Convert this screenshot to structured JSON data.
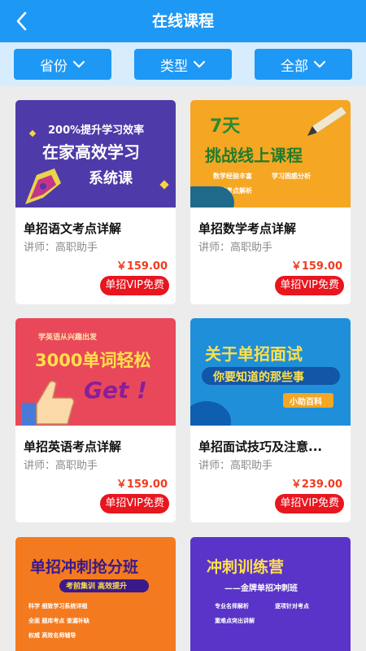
{
  "header": {
    "title": "在线课程"
  },
  "filters": [
    {
      "label": "省份"
    },
    {
      "label": "类型"
    },
    {
      "label": "全部"
    }
  ],
  "courses": [
    {
      "title": "单招语文考点详解",
      "teacher": "讲师：高职助手",
      "price": "￥159.00",
      "badge": "单招VIP免费",
      "thumb": {
        "line1": "200%提升学习效率",
        "line2": "在家高效学习",
        "line3": "系统课"
      }
    },
    {
      "title": "单招数学考点详解",
      "teacher": "讲师：高职助手",
      "price": "￥159.00",
      "badge": "单招VIP免费",
      "thumb": {
        "line1": "7天",
        "line2": "挑战线上课程",
        "bullet1": "数学经验丰富",
        "bullet2": "学习困惑分析",
        "bullet3": "课程考点解析"
      }
    },
    {
      "title": "单招英语考点详解",
      "teacher": "讲师：高职助手",
      "price": "￥159.00",
      "badge": "单招VIP免费",
      "thumb": {
        "line1": "学英语从兴趣出发",
        "line2": "3000单词轻松",
        "line3": "Get !"
      }
    },
    {
      "title": "单招面试技巧及注意...",
      "teacher": "讲师：高职助手",
      "price": "￥239.00",
      "badge": "单招VIP免费",
      "thumb": {
        "line1": "关于单招面试",
        "line2": "你要知道的那些事",
        "line3": "小助百科"
      }
    },
    {
      "title": "",
      "teacher": "",
      "price": "",
      "badge": "",
      "thumb": {
        "line1": "单招冲刺抢分班",
        "line2": "考前集训  高效提升",
        "bullet1": "科学  细致学习系统详细",
        "bullet2": "全面  题库考点  查漏补缺",
        "bullet3": "权威  高效名师辅导"
      }
    },
    {
      "title": "",
      "teacher": "",
      "price": "",
      "badge": "",
      "thumb": {
        "line1": "冲刺训练营",
        "line2": "——金牌单招冲刺班",
        "bullet1": "专业名师解析",
        "bullet2": "逐项针对考点",
        "bullet3": "重难点突出讲解"
      }
    }
  ],
  "colors": {
    "primary": "#1e98f5",
    "filterBar": "#d7edfd",
    "price": "#f03c1e",
    "badge": "#e8161f"
  }
}
